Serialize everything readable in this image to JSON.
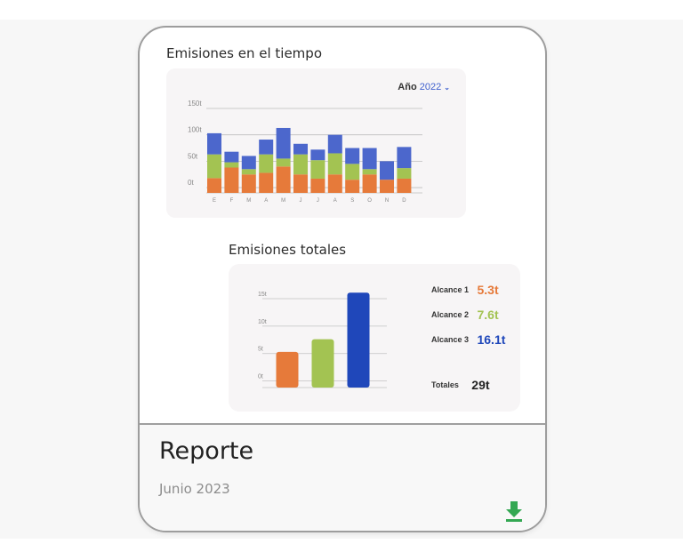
{
  "colors": {
    "alcance1": "#e67a3a",
    "alcance2": "#a3c352",
    "alcance3": "#1f47ba",
    "stack_top": "#4c67cc",
    "accent_link": "#3e5fce",
    "download_green": "#34a853"
  },
  "card": {
    "icon": "download-icon"
  },
  "time_section": {
    "title": "Emisiones en el tiempo",
    "year_label": "Año",
    "year_value": "2022"
  },
  "totals_section": {
    "title": "Emisiones totales",
    "legend": [
      {
        "label": "Alcance 1",
        "value": "5.3t",
        "color": "#e67a3a"
      },
      {
        "label": "Alcance 2",
        "value": "7.6t",
        "color": "#a3c352"
      },
      {
        "label": "Alcance 3",
        "value": "16.1t",
        "color": "#1f47ba"
      }
    ],
    "total_label": "Totales",
    "total_value": "29t"
  },
  "footer": {
    "title": "Reporte",
    "date": "Junio 2023"
  },
  "chart_data": [
    {
      "type": "bar",
      "stacked": true,
      "title": "Emisiones en el tiempo",
      "categories": [
        "E",
        "F",
        "M",
        "A",
        "M",
        "J",
        "J",
        "A",
        "S",
        "O",
        "N",
        "D"
      ],
      "yticks": [
        "0t",
        "50t",
        "100t",
        "150t"
      ],
      "ylim": [
        0,
        150
      ],
      "y_offset": 10,
      "series": [
        {
          "values": [
            18,
            38,
            25,
            28,
            40,
            25,
            17,
            25,
            15,
            25,
            15,
            17
          ],
          "color": "#e67a3a"
        },
        {
          "values": [
            45,
            10,
            10,
            35,
            15,
            38,
            35,
            40,
            30,
            10,
            0,
            20
          ],
          "color": "#a3c352"
        },
        {
          "values": [
            40,
            20,
            25,
            28,
            58,
            20,
            20,
            35,
            30,
            40,
            35,
            40
          ],
          "color": "#4c67cc"
        }
      ],
      "grid": true
    },
    {
      "type": "bar",
      "title": "Emisiones totales",
      "categories": [
        "Alcance 1",
        "Alcance 2",
        "Alcance 3"
      ],
      "values": [
        5.3,
        7.6,
        16.1
      ],
      "colors": [
        "#e67a3a",
        "#a3c352",
        "#1f47ba"
      ],
      "yticks": [
        "0t",
        "5t",
        "10t",
        "15t"
      ],
      "ylim": [
        0,
        15
      ],
      "y_offset": 1.2,
      "grid": true
    }
  ]
}
